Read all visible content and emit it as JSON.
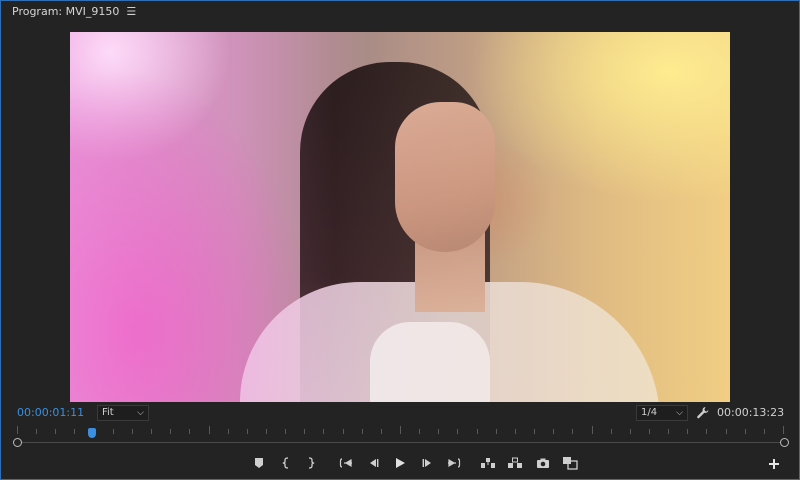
{
  "header": {
    "title": "Program: MVI_9150",
    "menu_icon": "hamburger-menu-icon"
  },
  "timecode": {
    "current": "00:00:01:11",
    "duration": "00:00:13:23",
    "current_color": "#3a8fde"
  },
  "zoom_select": {
    "value": "Fit"
  },
  "resolution_select": {
    "value": "1/4"
  },
  "icons": {
    "settings": "wrench-icon",
    "add": "plus-icon",
    "transport": [
      "add-marker-icon",
      "mark-in-icon",
      "mark-out-icon",
      "go-to-in-icon",
      "step-back-icon",
      "play-icon",
      "step-forward-icon",
      "go-to-out-icon",
      "lift-icon",
      "extract-icon",
      "export-frame-icon",
      "comparison-view-icon"
    ]
  },
  "colors": {
    "accent": "#3a8fde",
    "panel_bg": "#232323",
    "focus_border": "#2f6fb5"
  }
}
